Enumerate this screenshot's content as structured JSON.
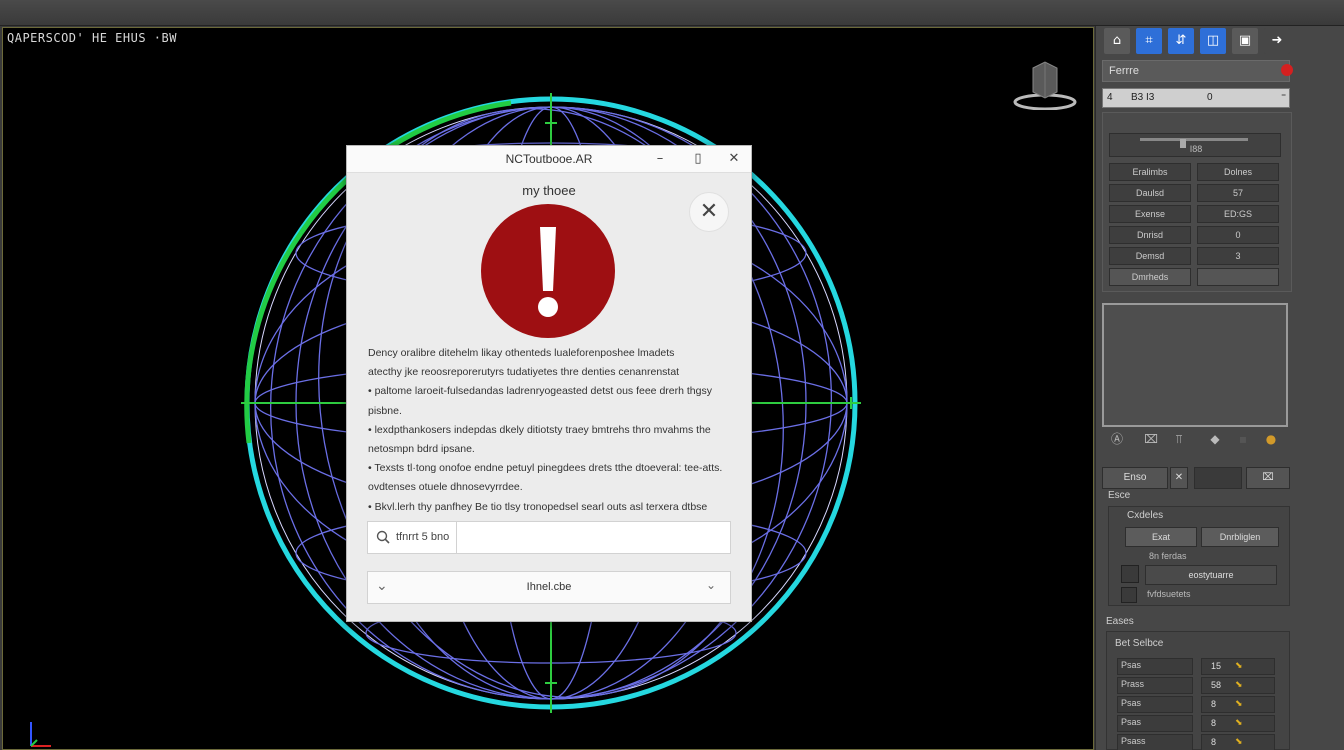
{
  "viewport": {
    "label": "QAPERSCOD' HE EHUS ·BW"
  },
  "dialog": {
    "title": "NCToutbooe.AR",
    "heading": "my thoee",
    "controls": {
      "minimize": "–",
      "maximize": "▯",
      "close": "✕"
    },
    "close_glyph": "✕",
    "alert_color": "#9e0f12",
    "body_lines": [
      "Dency oralibre ditehelm likay othenteds lualeforenposhee lmadets",
      "atecthy jke reoosreporerutyrs tudatiyetes thre denties cenanrenstat",
      "• paltome laroeit-fulsedandas ladrenryogeasted detst ous feee drerh thgsy",
      "pisbne.",
      "• lexdpthankosers indepdas dkely ditiotsty traey bmtrehs thro mvahms  the",
      "netosmpn bdrd ipsane.",
      "• Texsts tl·tong onofoe endne petuyl pinegdees drets tthe dtoeveral: tee-atts.",
      "ovdtenses otuele dhnosevyrrdee.",
      "• Bkvl.lerh thy panfhey Be tio tlsy tronopedsel searl outs asl terxera  dtbse"
    ],
    "search": {
      "label": "tfnrrt 5 bno",
      "placeholder": ""
    },
    "select": {
      "value": "Ihnel.cbe",
      "left_glyph": "⌄",
      "right_glyph": "⌄"
    }
  },
  "panel": {
    "tools": [
      {
        "icon": "create-icon",
        "glyph": "⌂",
        "color": "#5a5a5a"
      },
      {
        "icon": "modify-icon",
        "glyph": "⌗",
        "color": "#2e6fd8"
      },
      {
        "icon": "hierarchy-icon",
        "glyph": "⇵",
        "color": "#2e6fd8"
      },
      {
        "icon": "motion-icon",
        "glyph": "◫",
        "color": "#2e6fd8"
      },
      {
        "icon": "display-icon",
        "glyph": "▣",
        "color": "#5a5a5a"
      },
      {
        "icon": "utilities-icon",
        "glyph": "➜",
        "color": "#474747"
      }
    ],
    "object_name": "Ferrre",
    "object_field": {
      "left": "4",
      "mid": "B3 I3",
      "right": "0",
      "end": "⁼"
    },
    "slider": {
      "caption": "I88",
      "position_pct": 37
    },
    "props": [
      {
        "label": "Eralimbs",
        "value": "Dolnes"
      },
      {
        "label": "Daulsd",
        "value": "57"
      },
      {
        "label": "Exense",
        "value": "ED:GS"
      },
      {
        "label": "Dnrisd",
        "value": "0"
      },
      {
        "label": "Demsd",
        "value": "3"
      },
      {
        "label": "Dmrheds",
        "value": ""
      }
    ],
    "preview_icons": [
      "Ⓐ",
      "⌧",
      "⫪",
      "◆",
      "▪",
      "●"
    ],
    "modifier_tabs": {
      "a": "Enso",
      "b": "✕",
      "c": "",
      "d": "⌧"
    },
    "sections": {
      "section1": "Esce",
      "section2": "Eases",
      "group1_title": "Cxdeles",
      "params_title": "Bet Selbce"
    },
    "mod_buttons": {
      "left": "Exat",
      "right": "Dnrbliglen"
    },
    "mod_caption": "8n ferdas",
    "checks": [
      {
        "label": "eostytuarre"
      },
      {
        "label": "fvfdsuetets"
      }
    ],
    "params": [
      {
        "label": "Psas",
        "value": "15"
      },
      {
        "label": "Prass",
        "value": "58"
      },
      {
        "label": "Psas",
        "value": "8"
      },
      {
        "label": "Psas",
        "value": "8"
      },
      {
        "label": "Psass",
        "value": "8"
      }
    ]
  },
  "colors": {
    "viewport_bg": "#000000",
    "globe_outer_cyan": "#25d8e0",
    "globe_outer_green": "#22cc44",
    "globe_wire": "#6b6fe6",
    "axis_green": "#2ecc40"
  }
}
